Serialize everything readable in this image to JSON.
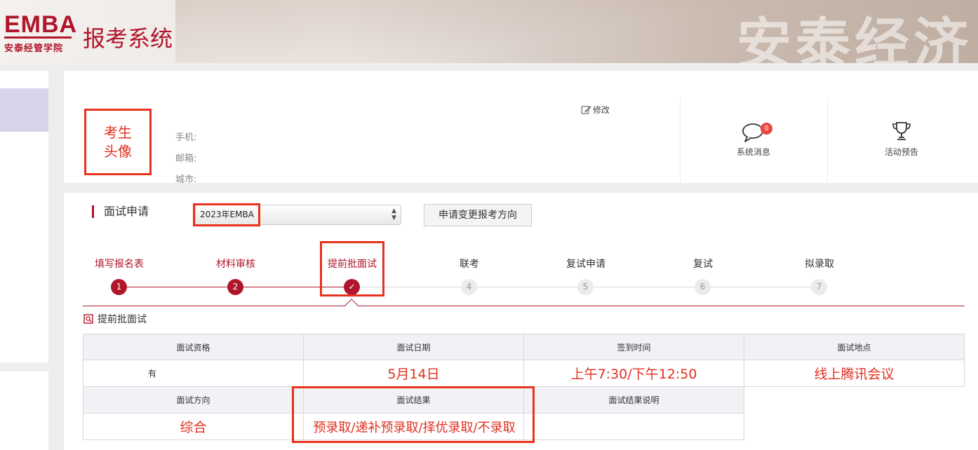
{
  "header": {
    "logo_mark": "EMBA",
    "logo_sub": "安泰经管学院",
    "system_title": "报考系统",
    "bg_text": "安泰经济"
  },
  "profile": {
    "avatar_line1": "考生",
    "avatar_line2": "头像",
    "phone_label": "手机:",
    "email_label": "邮箱:",
    "city_label": "城市:",
    "edit_label": "修改",
    "messages": {
      "label": "系统消息",
      "count": "0"
    },
    "activities": {
      "label": "活动预告"
    }
  },
  "application": {
    "section_title": "面试申请",
    "year_selected": "2023年EMBA",
    "change_button": "申请变更报考方向"
  },
  "steps": [
    {
      "label": "填写报名表",
      "num": "1",
      "status": "done"
    },
    {
      "label": "材料审核",
      "num": "2",
      "status": "done"
    },
    {
      "label": "提前批面试",
      "num": "✓",
      "status": "current"
    },
    {
      "label": "联考",
      "num": "4",
      "status": "todo"
    },
    {
      "label": "复试申请",
      "num": "5",
      "status": "todo"
    },
    {
      "label": "复试",
      "num": "6",
      "status": "todo"
    },
    {
      "label": "拟录取",
      "num": "7",
      "status": "todo"
    }
  ],
  "interview": {
    "title": "提前批面试",
    "headers1": [
      "面试资格",
      "面试日期",
      "签到时间",
      "面试地点"
    ],
    "row1": [
      "有",
      "5月14日",
      "上午7:30/下午12:50",
      "线上腾讯会议"
    ],
    "headers2": [
      "面试方向",
      "面试结果",
      "面试结果说明"
    ],
    "row2": [
      "综合",
      "预录取/递补预录取/择优录取/不录取",
      ""
    ]
  },
  "colors": {
    "brand": "#b0152b",
    "highlight": "#e8321e"
  }
}
